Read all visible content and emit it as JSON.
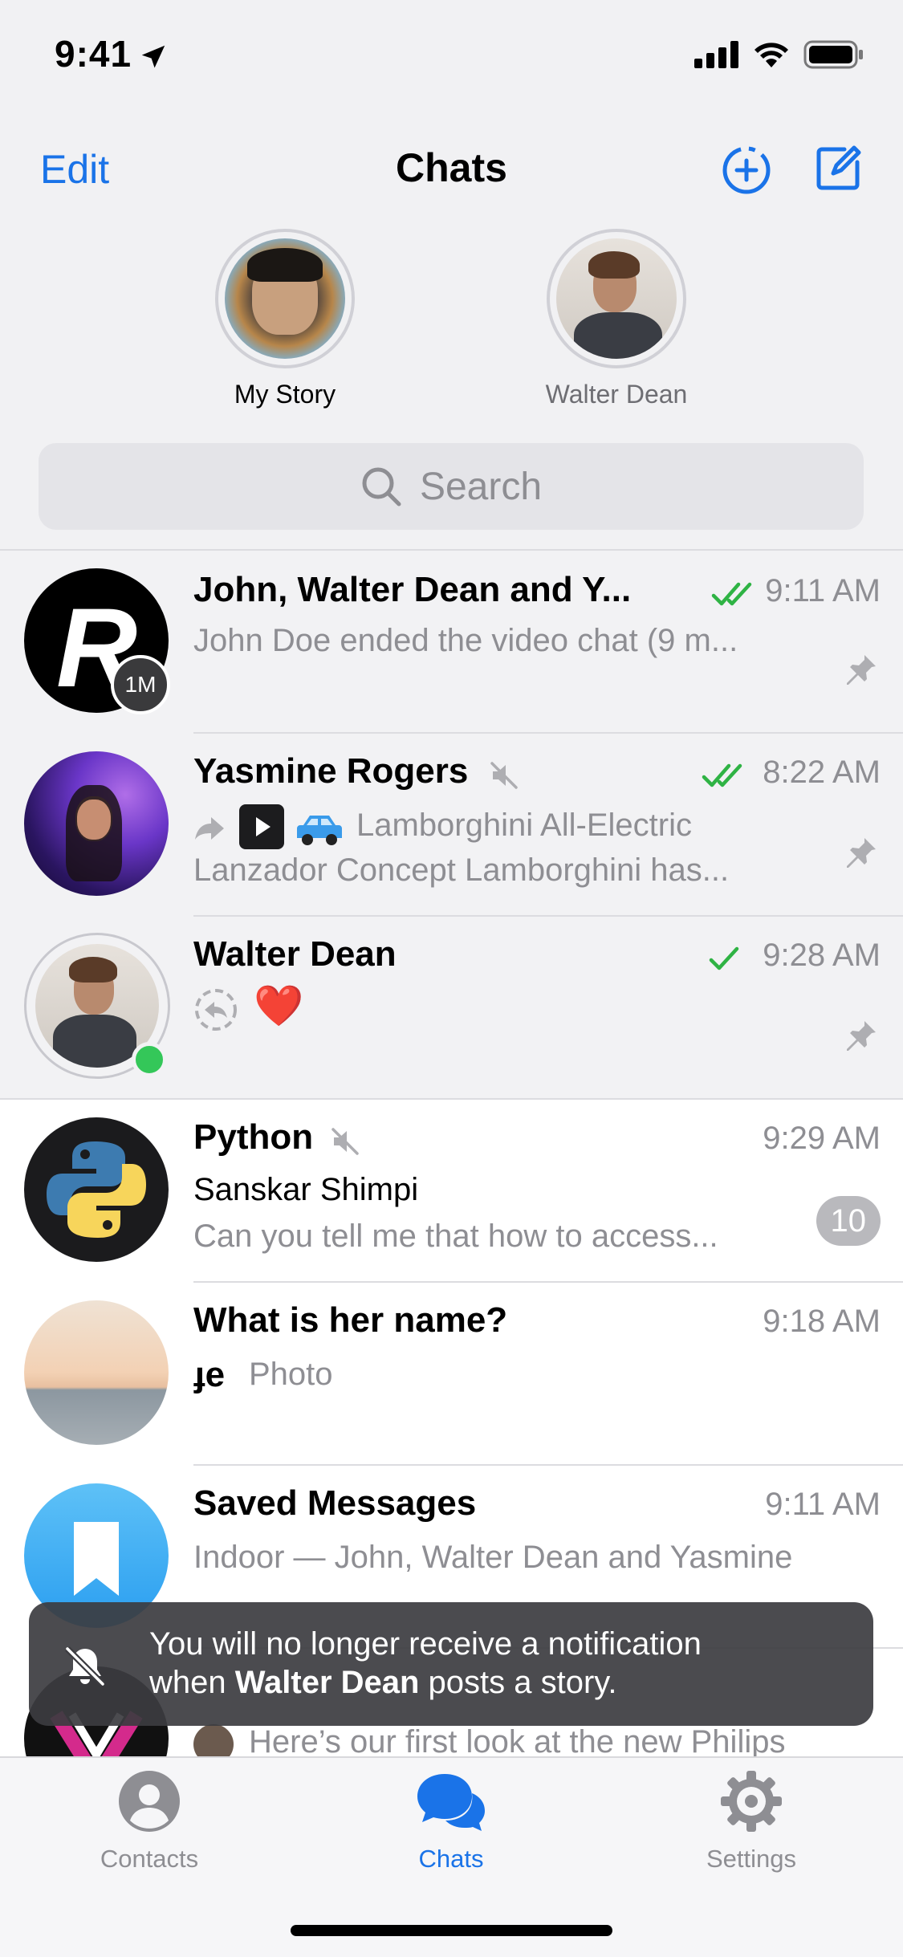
{
  "status": {
    "time": "9:41"
  },
  "nav": {
    "edit": "Edit",
    "title": "Chats"
  },
  "stories": [
    {
      "label": "My Story"
    },
    {
      "label": "Walter Dean"
    }
  ],
  "search": {
    "placeholder": "Search"
  },
  "chats": [
    {
      "title": "John, Walter Dean and Y...",
      "time": "9:11 AM",
      "preview": "John Doe ended the video chat (9 m...",
      "avatar_badge": "1M",
      "status": "read",
      "pinned": true
    },
    {
      "title": "Yasmine Rogers",
      "time": "8:22 AM",
      "preview_line1": "Lamborghini All-Electric",
      "preview_line2": "Lanzador Concept Lamborghini has...",
      "muted": true,
      "status": "read",
      "pinned": true
    },
    {
      "title": "Walter Dean",
      "time": "9:28 AM",
      "preview_emoji": "❤️",
      "status": "sent",
      "pinned": true,
      "online": true
    },
    {
      "title": "Python",
      "time": "9:29 AM",
      "sender": "Sanskar Shimpi",
      "preview": "Can you tell me that how to access...",
      "unread": "10",
      "muted": true
    },
    {
      "title": "What is her name?",
      "time": "9:18 AM",
      "preview_prefix": "ɟe",
      "preview": "Photo"
    },
    {
      "title": "Saved Messages",
      "time": "9:11 AM",
      "preview": "Indoor — John, Walter Dean and Yasmine"
    },
    {
      "preview": "Here’s our first look at the new Philips"
    }
  ],
  "toast": {
    "line1": "You will no longer receive a notification",
    "line2_prefix": "when ",
    "line2_bold": "Walter Dean",
    "line2_suffix": " posts a story."
  },
  "tabs": [
    {
      "label": "Contacts",
      "active": false
    },
    {
      "label": "Chats",
      "active": true
    },
    {
      "label": "Settings",
      "active": false
    }
  ],
  "colors": {
    "accent": "#1a73e8",
    "check": "#2fb344",
    "online": "#34c759",
    "secondary": "#8e8e93"
  }
}
